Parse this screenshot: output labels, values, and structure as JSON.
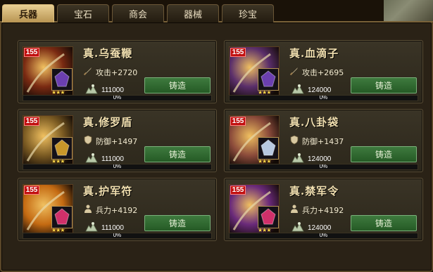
{
  "tabs": [
    {
      "label": "兵器",
      "active": true
    },
    {
      "label": "宝石",
      "active": false
    },
    {
      "label": "商会",
      "active": false
    },
    {
      "label": "器械",
      "active": false
    },
    {
      "label": "珍宝",
      "active": false
    }
  ],
  "items": [
    {
      "level": "155",
      "name": "真.乌蚕鞭",
      "stat_icon": "sword-icon",
      "stat": "攻击+2720",
      "cost": "111000",
      "button": "铸造",
      "progress_pct": 0,
      "progress_text": "0%",
      "stars": "★★★",
      "portrait_color": "#7a2a12",
      "gem_color": "#6b3fb0"
    },
    {
      "level": "155",
      "name": "真.血滴子",
      "stat_icon": "sword-icon",
      "stat": "攻击+2695",
      "cost": "124000",
      "button": "铸造",
      "progress_pct": 0,
      "progress_text": "0%",
      "stars": "★★★",
      "portrait_color": "#5a2e6a",
      "gem_color": "#6b3fb0"
    },
    {
      "level": "155",
      "name": "真.修罗盾",
      "stat_icon": "shield-icon",
      "stat": "防御+1497",
      "cost": "111000",
      "button": "铸造",
      "progress_pct": 0,
      "progress_text": "0%",
      "stars": "★★★",
      "portrait_color": "#7a5a22",
      "gem_color": "#c8962a"
    },
    {
      "level": "155",
      "name": "真.八卦袋",
      "stat_icon": "shield-icon",
      "stat": "防御+1437",
      "cost": "124000",
      "button": "铸造",
      "progress_pct": 0,
      "progress_text": "0%",
      "stars": "★★★",
      "portrait_color": "#8a4a3a",
      "gem_color": "#b8c8e0"
    },
    {
      "level": "155",
      "name": "真.护军符",
      "stat_icon": "soldier-icon",
      "stat": "兵力+4192",
      "cost": "111000",
      "button": "铸造",
      "progress_pct": 0,
      "progress_text": "0%",
      "stars": "★★★",
      "portrait_color": "#c46a12",
      "gem_color": "#d0306a"
    },
    {
      "level": "155",
      "name": "真.禁军令",
      "stat_icon": "soldier-icon",
      "stat": "兵力+4192",
      "cost": "124000",
      "button": "铸造",
      "progress_pct": 0,
      "progress_text": "0%",
      "stars": "★★★",
      "portrait_color": "#6a2a7a",
      "gem_color": "#d0306a"
    }
  ]
}
